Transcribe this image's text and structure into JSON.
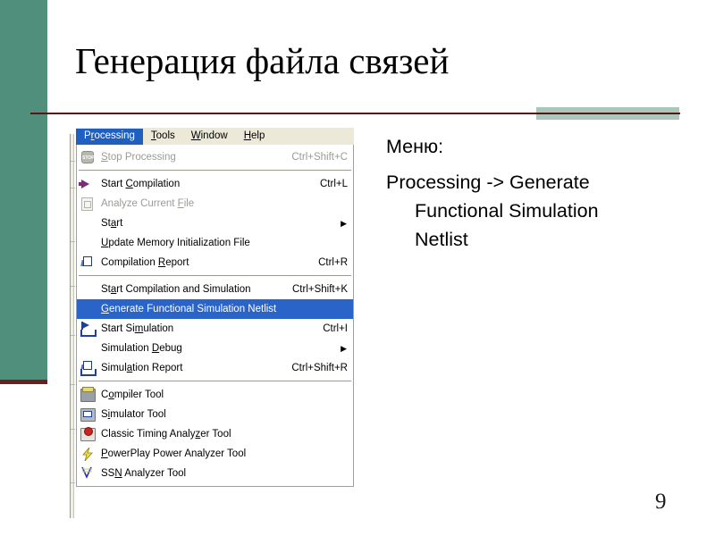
{
  "slide": {
    "title": "Генерация файла связей",
    "page_number": "9",
    "accent_teal": "#4f8f7b",
    "accent_dark_red": "#5c1414",
    "accent_sage": "#a9c7bb"
  },
  "body_text": {
    "heading": "Меню:",
    "lines": [
      "Processing -> Generate",
      "Functional Simulation",
      "Netlist"
    ]
  },
  "menu_window": {
    "menubar": [
      {
        "label": "Processing",
        "accel": "r",
        "active": true
      },
      {
        "label": "Tools",
        "accel": "T",
        "active": false
      },
      {
        "label": "Window",
        "accel": "W",
        "active": false
      },
      {
        "label": "Help",
        "accel": "H",
        "active": false
      }
    ],
    "groups": [
      {
        "items": [
          {
            "label": "Stop Processing",
            "accel_char": "S",
            "shortcut": "Ctrl+Shift+C",
            "icon": "stop-sign-icon",
            "disabled": true,
            "selected": false,
            "submenu": false
          }
        ]
      },
      {
        "items": [
          {
            "label": "Start Compilation",
            "accel_char": "C",
            "shortcut": "Ctrl+L",
            "icon": "play-arrow-icon",
            "disabled": false,
            "selected": false,
            "submenu": false
          },
          {
            "label": "Analyze Current File",
            "accel_char": "F",
            "shortcut": "",
            "icon": "analyze-document-icon",
            "disabled": true,
            "selected": false,
            "submenu": false
          },
          {
            "label": "Start",
            "accel_char": "a",
            "shortcut": "",
            "icon": "",
            "disabled": false,
            "selected": false,
            "submenu": true
          },
          {
            "label": "Update Memory Initialization File",
            "accel_char": "U",
            "shortcut": "",
            "icon": "",
            "disabled": false,
            "selected": false,
            "submenu": false
          },
          {
            "label": "Compilation Report",
            "accel_char": "R",
            "shortcut": "Ctrl+R",
            "icon": "compilation-report-icon",
            "disabled": false,
            "selected": false,
            "submenu": false
          }
        ]
      },
      {
        "items": [
          {
            "label": "Start Compilation and Simulation",
            "accel_char": "a",
            "shortcut": "Ctrl+Shift+K",
            "icon": "",
            "disabled": false,
            "selected": false,
            "submenu": false
          },
          {
            "label": "Generate Functional Simulation Netlist",
            "accel_char": "G",
            "shortcut": "",
            "icon": "",
            "disabled": false,
            "selected": true,
            "submenu": false
          },
          {
            "label": "Start Simulation",
            "accel_char": "m",
            "shortcut": "Ctrl+I",
            "icon": "start-simulation-icon",
            "disabled": false,
            "selected": false,
            "submenu": false
          },
          {
            "label": "Simulation Debug",
            "accel_char": "D",
            "shortcut": "",
            "icon": "",
            "disabled": false,
            "selected": false,
            "submenu": true
          },
          {
            "label": "Simulation Report",
            "accel_char": "a",
            "shortcut": "Ctrl+Shift+R",
            "icon": "simulation-report-icon",
            "disabled": false,
            "selected": false,
            "submenu": false
          }
        ]
      },
      {
        "items": [
          {
            "label": "Compiler Tool",
            "accel_char": "o",
            "shortcut": "",
            "icon": "compiler-tool-icon",
            "disabled": false,
            "selected": false,
            "submenu": false
          },
          {
            "label": "Simulator Tool",
            "accel_char": "i",
            "shortcut": "",
            "icon": "simulator-tool-icon",
            "disabled": false,
            "selected": false,
            "submenu": false
          },
          {
            "label": "Classic Timing Analyzer Tool",
            "accel_char": "z",
            "shortcut": "",
            "icon": "classic-timing-analyzer-icon",
            "disabled": false,
            "selected": false,
            "submenu": false
          },
          {
            "label": "PowerPlay Power Analyzer Tool",
            "accel_char": "P",
            "shortcut": "",
            "icon": "powerplay-bolt-icon",
            "disabled": false,
            "selected": false,
            "submenu": false
          },
          {
            "label": "SSN Analyzer Tool",
            "accel_char": "N",
            "shortcut": "",
            "icon": "ssn-analyzer-icon",
            "disabled": false,
            "selected": false,
            "submenu": false
          }
        ]
      }
    ]
  }
}
